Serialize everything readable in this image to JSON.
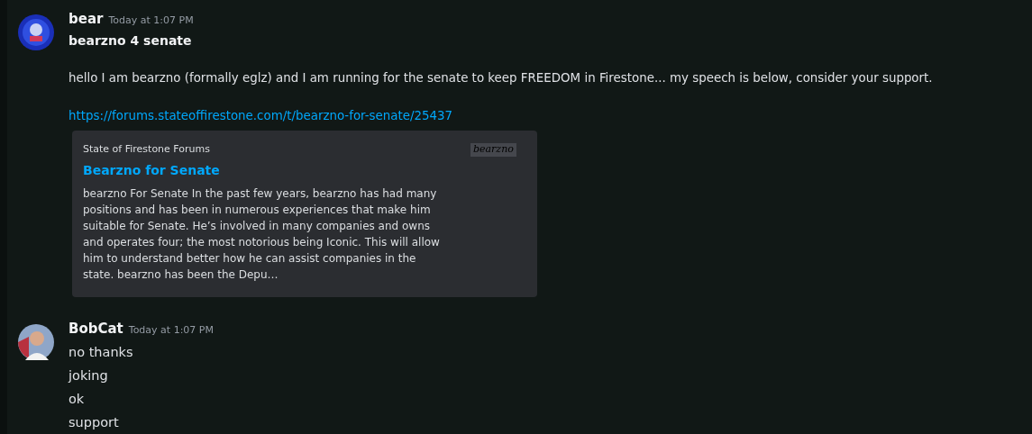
{
  "messages": [
    {
      "author": "bear",
      "timestamp": "Today at 1:07 PM",
      "avatar": {
        "kind": "picture"
      },
      "content": [
        {
          "kind": "heading",
          "text": "bearzno 4 senate"
        },
        {
          "kind": "paragraph",
          "text": "hello I am bearzno (formally eglz) and I am running for the senate to keep FREEDOM in Firestone... my speech is below, consider your support."
        },
        {
          "kind": "link",
          "text": "https://forums.stateoffirestone.com/t/bearzno-for-senate/25437"
        }
      ],
      "embed": {
        "provider": "State of Firestone Forums",
        "title": "Bearzno for Senate",
        "logo_text": "bearzno",
        "description": "bearzno For Senate In the past few years, bearzno has had many positions and has been in numerous experiences that make him suitable for Senate. He’s involved in many companies and owns and operates four; the most notorious being Iconic. This will allow him to understand better how he can assist companies in the state. bearzno has been the Depu…"
      }
    },
    {
      "author": "BobCat",
      "timestamp": "Today at 1:07 PM",
      "avatar": {
        "kind": "picture"
      },
      "content": [
        {
          "kind": "line",
          "text": "no thanks"
        },
        {
          "kind": "line",
          "text": "joking"
        },
        {
          "kind": "line",
          "text": "ok"
        },
        {
          "kind": "line",
          "text": "support"
        }
      ]
    }
  ]
}
